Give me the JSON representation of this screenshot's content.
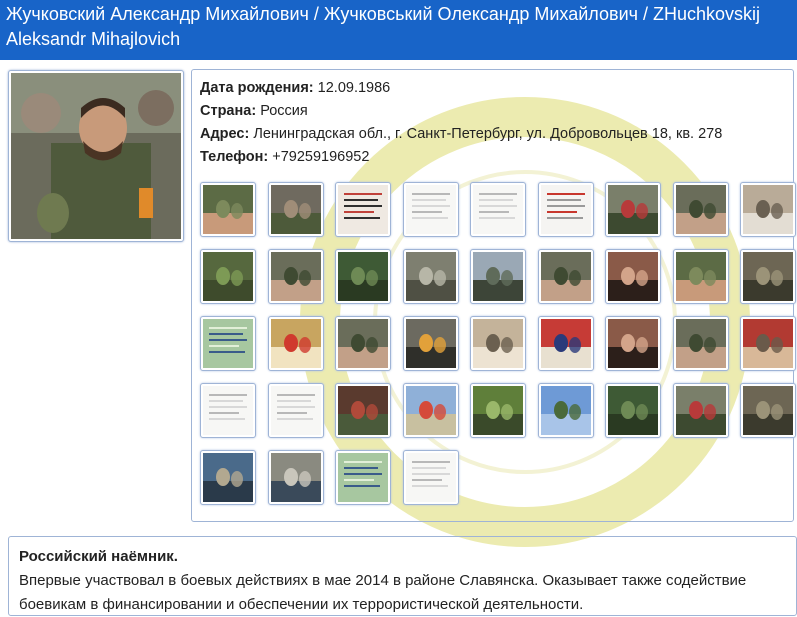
{
  "header": {
    "title": "Жучковский Александр Михайлович / Жучковський Олександр Михайлович / ZHuchkovskij Aleksandr Mihajlovich"
  },
  "profile": {
    "birth_label": "Дата рождения:",
    "birth_value": "12.09.1986",
    "country_label": "Страна:",
    "country_value": "Россия",
    "address_label": "Адрес:",
    "address_value": "Ленинградская обл., г. Санкт-Петербург, ул. Добровольцев 18, кв. 278",
    "phone_label": "Телефон:",
    "phone_value": "+79259196952"
  },
  "gallery": {
    "rows": [
      [
        "photo-green",
        "photo-crowd",
        "doc-passport",
        "doc-text",
        "doc-text",
        "doc-red",
        "photo-flag",
        "photo-group",
        "photo-room"
      ],
      [
        "photo-field",
        "photo-group",
        "photo-trees",
        "photo-ruin",
        "photo-apc",
        "photo-group",
        "photo-woman",
        "photo-green",
        "photo-camp"
      ],
      [
        "doc-certificate",
        "photo-icon",
        "photo-group",
        "photo-ribbon",
        "photo-indoor",
        "photo-flag-red",
        "photo-woman",
        "photo-group",
        "photo-room-red"
      ],
      [
        "doc-text",
        "doc-text",
        "photo-tent",
        "photo-sign",
        "photo-man",
        "photo-sky",
        "photo-trees",
        "photo-flag",
        "photo-camp"
      ],
      [
        "photo-table",
        "photo-truck",
        "doc-certificate",
        "doc-text"
      ]
    ]
  },
  "bio": {
    "title": "Российский наёмник.",
    "text": "Впервые участвовал в боевых действиях в мае 2014 в районе Славянска. Оказывает также содействие боевикам в финансировании и обеспечении их террористической деятельности."
  },
  "colors": {
    "header_bg": "#1864c8",
    "frame_border": "#9fb4d6",
    "watermark": "#e3e28a"
  }
}
